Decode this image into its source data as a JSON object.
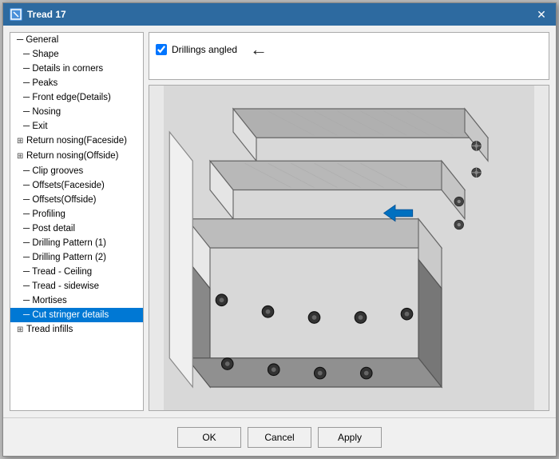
{
  "window": {
    "title": "Tread 17",
    "icon": "T"
  },
  "tree": {
    "items": [
      {
        "id": "general",
        "label": "General",
        "indent": 0,
        "type": "leaf"
      },
      {
        "id": "shape",
        "label": "Shape",
        "indent": 1,
        "type": "leaf"
      },
      {
        "id": "details-corners",
        "label": "Details in corners",
        "indent": 1,
        "type": "leaf"
      },
      {
        "id": "peaks",
        "label": "Peaks",
        "indent": 1,
        "type": "leaf"
      },
      {
        "id": "front-edge",
        "label": "Front edge(Details)",
        "indent": 1,
        "type": "leaf"
      },
      {
        "id": "nosing",
        "label": "Nosing",
        "indent": 1,
        "type": "leaf"
      },
      {
        "id": "exit",
        "label": "Exit",
        "indent": 1,
        "type": "leaf"
      },
      {
        "id": "return-nosing-faceside",
        "label": "Return nosing(Faceside)",
        "indent": 0,
        "type": "expandable"
      },
      {
        "id": "return-nosing-offside",
        "label": "Return nosing(Offside)",
        "indent": 0,
        "type": "expandable"
      },
      {
        "id": "clip-grooves",
        "label": "Clip grooves",
        "indent": 1,
        "type": "leaf"
      },
      {
        "id": "offsets-faceside",
        "label": "Offsets(Faceside)",
        "indent": 1,
        "type": "leaf"
      },
      {
        "id": "offsets-offside",
        "label": "Offsets(Offside)",
        "indent": 1,
        "type": "leaf"
      },
      {
        "id": "profiling",
        "label": "Profiling",
        "indent": 1,
        "type": "leaf"
      },
      {
        "id": "post-detail",
        "label": "Post detail",
        "indent": 1,
        "type": "leaf"
      },
      {
        "id": "drilling-pattern-1",
        "label": "Drilling Pattern (1)",
        "indent": 1,
        "type": "leaf"
      },
      {
        "id": "drilling-pattern-2",
        "label": "Drilling Pattern (2)",
        "indent": 1,
        "type": "leaf"
      },
      {
        "id": "tread-ceiling",
        "label": "Tread - Ceiling",
        "indent": 1,
        "type": "leaf"
      },
      {
        "id": "tread-sidewise",
        "label": "Tread - sidewise",
        "indent": 1,
        "type": "leaf"
      },
      {
        "id": "mortises",
        "label": "Mortises",
        "indent": 1,
        "type": "leaf"
      },
      {
        "id": "cut-stringer-details",
        "label": "Cut stringer details",
        "indent": 1,
        "type": "leaf",
        "selected": true
      },
      {
        "id": "tread-infills",
        "label": "Tread infills",
        "indent": 0,
        "type": "expandable"
      }
    ]
  },
  "options": {
    "drillings_angled": {
      "label": "Drillings angled",
      "checked": true
    }
  },
  "buttons": {
    "ok": "OK",
    "cancel": "Cancel",
    "apply": "Apply"
  },
  "arrows": {
    "tree_arrow": "←",
    "option_arrow": "←"
  }
}
